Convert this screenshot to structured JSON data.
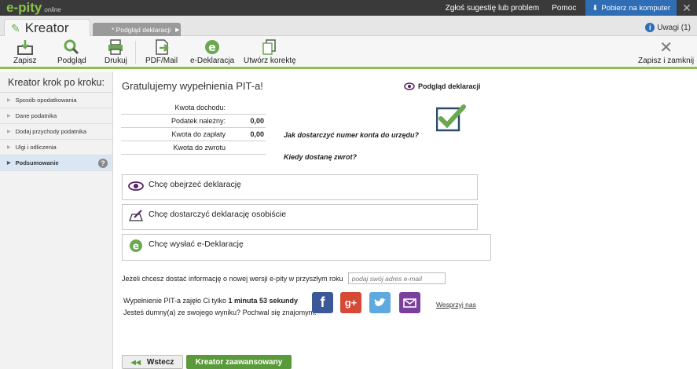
{
  "app": {
    "logo_text": "e-pity",
    "logo_suffix": "online"
  },
  "top_links": {
    "suggest": "Zgłoś sugestię lub problem",
    "help": "Pomoc",
    "download": "Pobierz na komputer"
  },
  "tabs": {
    "active": "Kreator",
    "inactive": "* Podgląd deklaracji",
    "help": "Uwagi (1)"
  },
  "toolbar": {
    "save": "Zapisz",
    "preview": "Podgląd",
    "print": "Drukuj",
    "pdf": "PDF/Mail",
    "edecl": "e-Deklaracja",
    "correction": "Utwórz korektę",
    "save_close": "Zapisz i zamknij"
  },
  "sidebar": {
    "title": "Kreator krok po kroku:",
    "items": [
      {
        "label": "Sposób opodatkowania"
      },
      {
        "label": "Dane podatnika"
      },
      {
        "label": "Dodaj przychody podatnika"
      },
      {
        "label": "Ulgi i odliczenia"
      },
      {
        "label": "Podsumowanie"
      }
    ]
  },
  "main": {
    "heading": "Gratulujemy wypełnienia PIT-a!",
    "preview_link": "Podgląd deklaracji",
    "summary": [
      {
        "label": "Kwota dochodu:",
        "value": ""
      },
      {
        "label": "Podatek należny:",
        "value": "0,00"
      },
      {
        "label": "Kwota do zapłaty",
        "value": "0,00"
      },
      {
        "label": "Kwota do zwrotu",
        "value": ""
      }
    ],
    "question1": "Jak dostarczyć numer konta do urzędu?",
    "question2": "Kiedy dostanę zwrot?",
    "options": [
      "Chcę obejrzeć deklarację",
      "Chcę dostarczyć deklarację osobiście",
      "Chcę wysłać e-Deklarację"
    ],
    "newsletter_text": "Jeżeli chcesz dostać informację o nowej wersji e-pity w przyszłym roku",
    "email_placeholder": "podaj swój adres e-mail",
    "time_prefix": "Wypełnienie PIT-a zajęło Ci tylko",
    "time_value": "1 minuta 53 sekundy",
    "proud_text": "Jesteś dumny(a) ze swojego wyniku? Pochwal się znajomym!",
    "support": "Wesprzyj nas",
    "back": "Wstecz",
    "advanced": "Kreator zaawansowany"
  },
  "colors": {
    "accent": "#8bc34a",
    "button_green": "#5a9a3a",
    "blue": "#2f6db5"
  }
}
